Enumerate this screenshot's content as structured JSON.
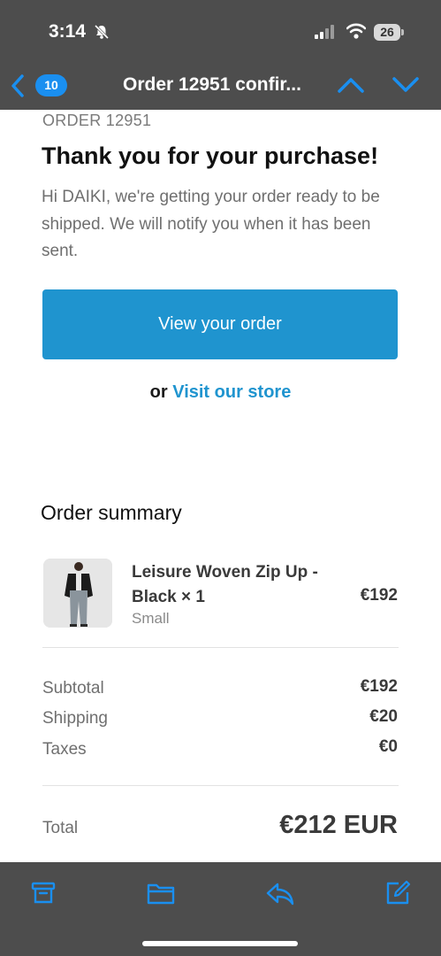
{
  "status_bar": {
    "time": "3:14",
    "battery": "26",
    "icons": [
      "bell-slash-icon",
      "cellular-signal-icon",
      "wifi-icon",
      "battery-icon"
    ]
  },
  "nav": {
    "unread_count": "10",
    "title": "Order 12951 confir...",
    "icons": [
      "chevron-left-icon",
      "chevron-up-icon",
      "chevron-down-icon"
    ]
  },
  "email": {
    "order_label": "ORDER 12951",
    "headline": "Thank you for your purchase!",
    "intro": "Hi DAIKI, we're getting your order ready to be shipped. We will notify you when it has been sent.",
    "view_order_button": "View your order",
    "store_prefix": "or",
    "store_link": "Visit our store",
    "summary_title": "Order summary",
    "item": {
      "name": "Leisure Woven Zip Up - Black × 1",
      "variant": "Small",
      "price": "€192"
    },
    "costs": [
      {
        "label": "Subtotal",
        "value": "€192"
      },
      {
        "label": "Shipping",
        "value": "€20"
      },
      {
        "label": "Taxes",
        "value": "€0"
      }
    ],
    "total": {
      "label": "Total",
      "value": "€212 EUR"
    }
  },
  "toolbar": {
    "icons": [
      "archive-icon",
      "folder-icon",
      "reply-icon",
      "compose-icon"
    ]
  },
  "colors": {
    "bar": "#4d4d4d",
    "accent": "#1f94cf",
    "ios_blue": "#1a8ff0"
  }
}
